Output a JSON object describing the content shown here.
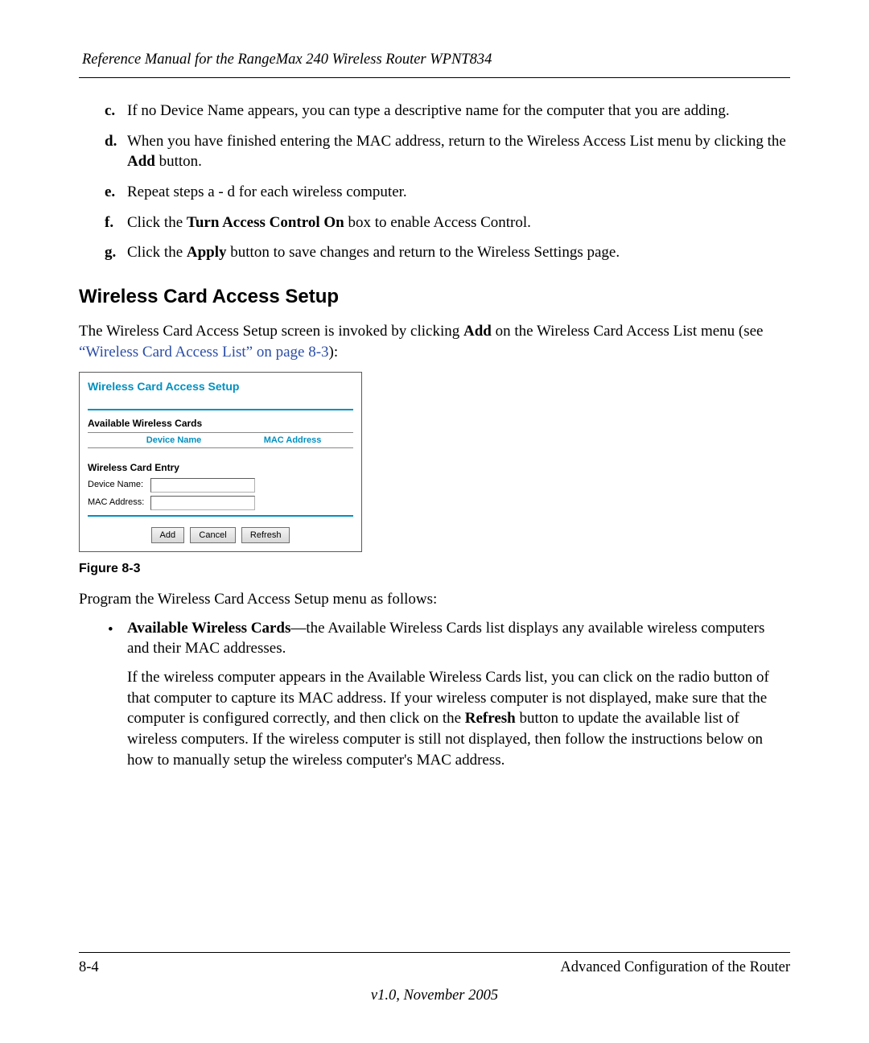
{
  "header": {
    "title": "Reference Manual for the RangeMax 240 Wireless Router WPNT834"
  },
  "steps": {
    "c": {
      "marker": "c.",
      "text_before": "If no Device Name appears, you can type a descriptive name for the computer that you are adding."
    },
    "d": {
      "marker": "d.",
      "text1": "When you have finished entering the MAC address, return to the Wireless Access List menu by clicking the ",
      "bold": "Add",
      "text2": " button."
    },
    "e": {
      "marker": "e.",
      "text": "Repeat steps a - d for each wireless computer."
    },
    "f": {
      "marker": "f.",
      "text1": "Click the ",
      "bold": "Turn Access Control On",
      "text2": " box to enable Access Control."
    },
    "g": {
      "marker": "g.",
      "text1": "Click the ",
      "bold": "Apply",
      "text2": " button to save changes and return to the Wireless Settings page."
    }
  },
  "section": {
    "heading": "Wireless Card Access Setup",
    "intro1": "The Wireless Card Access Setup screen is invoked by clicking ",
    "intro_bold": "Add",
    "intro2": " on the Wireless Card Access List menu (see ",
    "xref": "“Wireless Card Access List” on page 8-3",
    "intro3": "):"
  },
  "figure": {
    "title": "Wireless Card Access Setup",
    "available_label": "Available Wireless Cards",
    "col_device": "Device Name",
    "col_mac": "MAC Address",
    "entry_label": "Wireless Card Entry",
    "device_name_label": "Device Name:",
    "mac_label": "MAC Address:",
    "btn_add": "Add",
    "btn_cancel": "Cancel",
    "btn_refresh": "Refresh",
    "caption": "Figure 8-3"
  },
  "program": {
    "intro": "Program the Wireless Card Access Setup menu as follows:",
    "bullet1_bold": "Available Wireless Cards",
    "bullet1_text": "—the Available Wireless Cards list displays any available wireless computers and their MAC addresses.",
    "bullet1_para1": "If the wireless computer appears in the Available Wireless Cards list, you can click on the radio button of that computer to capture its MAC address. If your wireless computer is not displayed, make sure that the computer is configured correctly, and then click on the ",
    "bullet1_para_bold": "Refresh",
    "bullet1_para2": " button to update the available list of wireless computers. If the wireless computer is still not displayed, then follow the instructions below on how to manually setup the wireless computer's MAC address."
  },
  "footer": {
    "page": "8-4",
    "chapter": "Advanced Configuration of the Router",
    "version": "v1.0, November 2005"
  }
}
